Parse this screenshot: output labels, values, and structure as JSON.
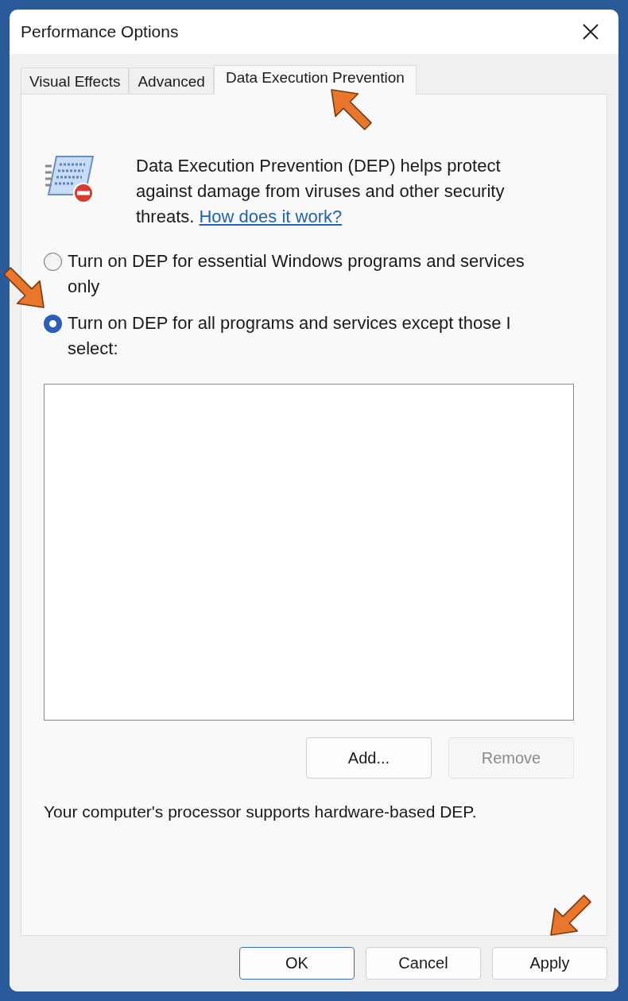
{
  "window": {
    "title": "Performance Options"
  },
  "tabs": [
    {
      "label": "Visual Effects",
      "selected": false
    },
    {
      "label": "Advanced",
      "selected": false
    },
    {
      "label": "Data Execution Prevention",
      "selected": true
    }
  ],
  "description": {
    "text": "Data Execution Prevention (DEP) helps protect against damage from viruses and other security threats.",
    "link": "How does it work?"
  },
  "options": [
    {
      "label": "Turn on DEP for essential Windows programs and services only",
      "selected": false
    },
    {
      "label": "Turn on DEP for all programs and services except those I select:",
      "selected": true
    }
  ],
  "list_buttons": [
    {
      "label": "Add...",
      "disabled": false
    },
    {
      "label": "Remove",
      "disabled": true
    }
  ],
  "status": "Your computer's processor supports hardware-based DEP.",
  "buttons": [
    {
      "label": "OK",
      "default": true
    },
    {
      "label": "Cancel",
      "default": false
    },
    {
      "label": "Apply",
      "default": false
    }
  ]
}
